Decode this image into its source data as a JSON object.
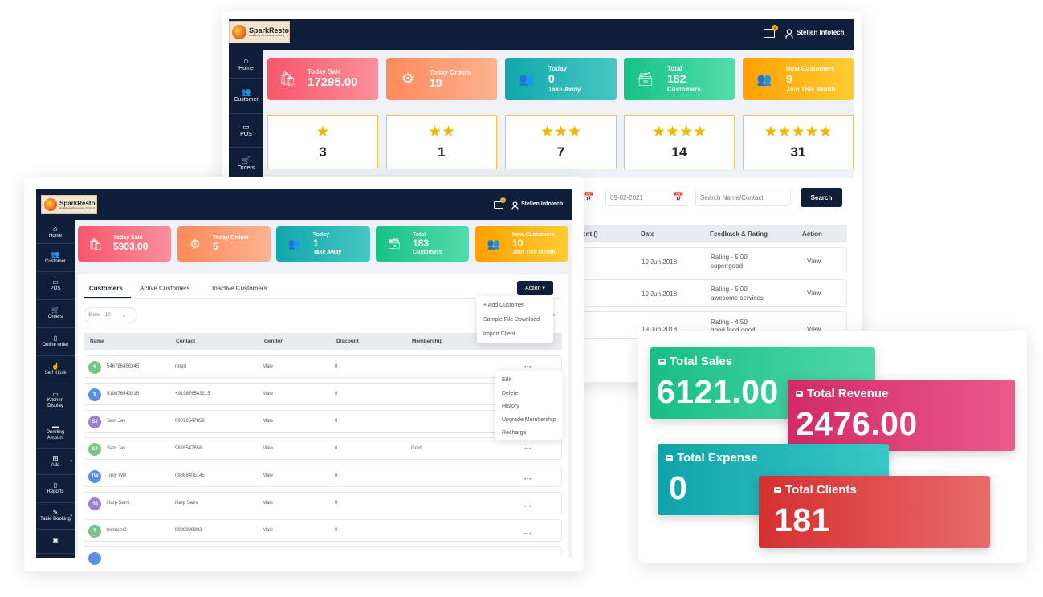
{
  "back": {
    "brand": {
      "name": "SparkResto",
      "tagline": "Redefining the Concept of Dining"
    },
    "user": "Stellen Infotech",
    "notif_count": "1",
    "sidebar": [
      {
        "label": "Home",
        "icon": "home-icon"
      },
      {
        "label": "Customer",
        "icon": "users-icon"
      },
      {
        "label": "POS",
        "icon": "monitor-icon"
      },
      {
        "label": "Orders",
        "icon": "cart-icon"
      }
    ],
    "stats": [
      {
        "label": "Today Sale",
        "value": "17295.00",
        "sub": "",
        "icon": "bag-icon"
      },
      {
        "label": "Today Orders",
        "value": "19",
        "sub": "",
        "icon": "gear-icon"
      },
      {
        "label": "Today",
        "value": "0",
        "sub": "Take Away",
        "icon": "users-icon"
      },
      {
        "label": "Total",
        "value": "182",
        "sub": "Customers",
        "icon": "archive-icon"
      },
      {
        "label": "New Customers",
        "value": "9",
        "sub": "Join This Month",
        "icon": "users-icon"
      }
    ],
    "ratings": [
      {
        "stars": "★",
        "count": "3"
      },
      {
        "stars": "★★",
        "count": "1"
      },
      {
        "stars": "★★★",
        "count": "7"
      },
      {
        "stars": "★★★★",
        "count": "14"
      },
      {
        "stars": "★★★★★",
        "count": "31"
      }
    ],
    "date_value": "09-02-2021",
    "search_placeholder": "Search Name/Contact",
    "search_label": "Search",
    "table_headers": [
      "ment ()",
      "Date",
      "Feedback & Rating",
      "Action"
    ],
    "rows": [
      {
        "date": "19 Jun,2018",
        "rating": "Rating - 5.00",
        "comment": "super good",
        "action": "View"
      },
      {
        "date": "19 Jun,2018",
        "rating": "Rating - 5.00",
        "comment": "awesome services",
        "action": "View"
      },
      {
        "date": "19 Jun,2018",
        "rating": "Rating - 4.50",
        "comment": "good food good",
        "action": "View"
      }
    ]
  },
  "front": {
    "brand": {
      "name": "SparkResto",
      "tagline": "Redefining the Concept of Dining"
    },
    "user": "Stellen Infotech",
    "notif_count": "1",
    "sidebar": [
      {
        "label": "Home",
        "icon": "home-icon"
      },
      {
        "label": "Customer",
        "icon": "users-icon"
      },
      {
        "label": "POS",
        "icon": "monitor-icon"
      },
      {
        "label": "Orders",
        "icon": "cart-icon"
      },
      {
        "label": "Online order",
        "icon": "phone-icon"
      },
      {
        "label": "Self Kiosk",
        "icon": "touch-icon"
      },
      {
        "label": "Kitchen Display",
        "icon": "display-icon"
      },
      {
        "label": "Pending Amount",
        "icon": "card-icon"
      },
      {
        "label": "Add",
        "icon": "plus-icon"
      },
      {
        "label": "Reports",
        "icon": "file-icon"
      },
      {
        "label": "Table Booking",
        "icon": "edit-icon"
      },
      {
        "label": "",
        "icon": "briefcase-icon"
      }
    ],
    "stats": [
      {
        "label": "Today Sale",
        "value": "5903.00",
        "sub": "",
        "icon": "bag-icon"
      },
      {
        "label": "Today Orders",
        "value": "5",
        "sub": "",
        "icon": "gear-icon"
      },
      {
        "label": "Today",
        "value": "1",
        "sub": "Take Away",
        "icon": "users-icon"
      },
      {
        "label": "Total",
        "value": "183",
        "sub": "Customers",
        "icon": "archive-icon"
      },
      {
        "label": "New Customers",
        "value": "10",
        "sub": "Join This Month",
        "icon": "users-icon"
      }
    ],
    "tabs": [
      "Customers",
      "Active Customers",
      "Inactive Customers"
    ],
    "action_label": "Action ▾",
    "action_menu": [
      "+ Add Customer",
      "Sample File Download",
      "Import Client"
    ],
    "show_label": "Show",
    "show_value": "10",
    "columns": [
      "Name",
      "Contact",
      "Gender",
      "Discount",
      "Membership"
    ],
    "row_menu": [
      "Edit",
      "Delete",
      "History",
      "Upgrade Membership",
      "Recharge"
    ],
    "customers": [
      {
        "initials": "5",
        "name": "546786456345",
        "contact": "retert",
        "gender": "Male",
        "discount": "0",
        "membership": "",
        "color": "#7cc08a"
      },
      {
        "initials": "9",
        "name": "919876543215",
        "contact": "+919876543215",
        "gender": "Male",
        "discount": "0",
        "membership": "",
        "color": "#5b8fe3"
      },
      {
        "initials": "SJ",
        "name": "Sam Jay",
        "contact": "09876547858",
        "gender": "Male",
        "discount": "0",
        "membership": "",
        "color": "#9c7ed6"
      },
      {
        "initials": "SJ",
        "name": "Sam Jay",
        "contact": "9876547858",
        "gender": "Male",
        "discount": "0",
        "membership": "Gold",
        "color": "#7cc08a"
      },
      {
        "initials": "TW",
        "name": "Tony Will",
        "contact": "09888405145",
        "gender": "Male",
        "discount": "0",
        "membership": "",
        "color": "#5b8fe3"
      },
      {
        "initials": "HS",
        "name": "Harp Saini",
        "contact": "Harp Saini",
        "gender": "Male",
        "discount": "0",
        "membership": "",
        "color": "#9c7ed6"
      },
      {
        "initials": "T",
        "name": "testuser2",
        "contact": "9999999992",
        "gender": "Male",
        "discount": "0",
        "membership": "",
        "color": "#7cc08a"
      }
    ]
  },
  "summary": [
    {
      "label": "Total Sales",
      "value": "6121.00",
      "color": "#1fc18b"
    },
    {
      "label": "Total Revenue",
      "value": "2476.00",
      "color": "#d8336e"
    },
    {
      "label": "Total Expense",
      "value": "0",
      "color": "#10a8ad"
    },
    {
      "label": "Total Clients",
      "value": "181",
      "color": "#d83b3b"
    }
  ]
}
